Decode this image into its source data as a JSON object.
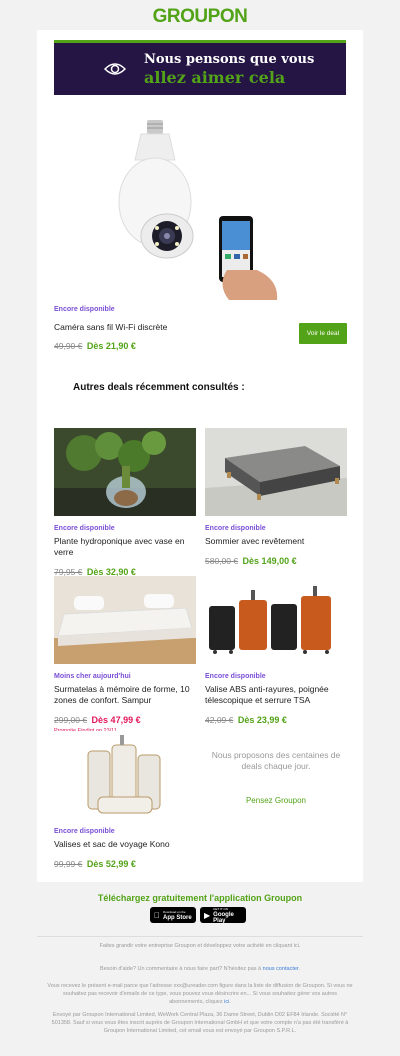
{
  "header": {
    "logo": "GROUPON"
  },
  "hero": {
    "line1": "Nous pensons que vous",
    "line2": "allez aimer cela"
  },
  "featured": {
    "badge": "Encore disponible",
    "title": "Caméra sans fil Wi-Fi discrète",
    "old_price": "49,90 €",
    "new_price": "Dès 21,90 €",
    "button": "Voir le deal"
  },
  "section_title": "Autres deals récemment consultés :",
  "deals": [
    {
      "badge": "Encore disponible",
      "title": "Plante hydroponique avec vase en verre",
      "old_price": "79,95 €",
      "new_price": "Dès 32,90 €"
    },
    {
      "badge": "Encore disponible",
      "title": "Sommier avec revêtement",
      "old_price": "580,00 €",
      "new_price": "Dès 149,00 €"
    },
    {
      "badge": "Moins cher aujourd'hui",
      "title": "Surmatelas à mémoire de forme, 10 zones de confort. Sampur",
      "old_price": "299,00 €",
      "new_price": "Dès 47,99 €",
      "promo": "Promotie Eindigt op 23/11"
    },
    {
      "badge": "Encore disponible",
      "title": "Valise ABS anti-rayures, poignée télescopique et serrure TSA",
      "old_price": "42,09 €",
      "new_price": "Dès 23,99 €"
    },
    {
      "badge": "Encore disponible",
      "title": "Valises et sac de voyage Kono",
      "old_price": "99,99 €",
      "new_price": "Dès 52,99 €"
    }
  ],
  "promo_block": {
    "message": "Nous proposons des centaines de deals chaque jour.",
    "link": "Pensez Groupon"
  },
  "app": {
    "title": "Téléchargez gratuitement l'application Groupon",
    "appstore_small": "Download on the",
    "appstore": "App Store",
    "gplay_small": "GET IT ON",
    "gplay": "Google Play"
  },
  "footer": {
    "line1": "Faites grandir votre entreprise Groupon et développez votre activité en cliquant ici.",
    "help_text": "Besoin d'aide? Un commentaire à nous faire part? N'hésitez pas à",
    "help_link": "nous contacter",
    "unsub_text": "Vous recevez le présent e-mail parce que l'adresse xxx@ureader.com figure dans la liste de diffusion de Groupon. Si vous ne souhaitez pas recevoir d'emails de ce type, vous pouvez vous désincrire en... Si vous souhaitez gérer vos autres abonnements, cliquez",
    "unsub_link": "ici",
    "legal": "Envoyé par Groupon International Limited, WeWork Central Plaza, 36 Dame Street, Dublin D02 EF84 Irlande. Société N° 501358. Sauf si vous vous êtes inscrit auprès de Groupon International GmbH et que votre compte n'a pas été transféré à Groupon International Limited, cet email vous est envoyé par Groupon S.P.R.L."
  },
  "colors": {
    "brand_green": "#53a318",
    "hero_bg": "#251544",
    "badge_purple": "#7a4fd6",
    "sale_red": "#e3175b"
  }
}
